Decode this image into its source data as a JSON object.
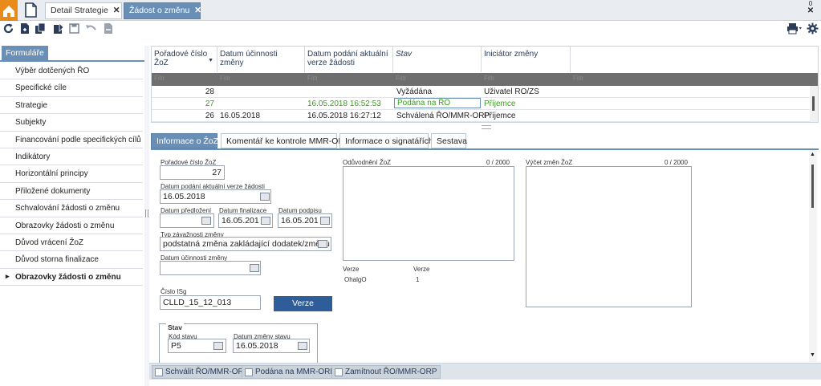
{
  "tabs": [
    {
      "label": "Detail Strategie",
      "close": "✕"
    },
    {
      "label": "Žádost o změnu",
      "close": "✕"
    }
  ],
  "window": {
    "minimize": "0",
    "close": "✕"
  },
  "left_panel": {
    "header": "Formuláře",
    "items": [
      "Výběr dotčených ŘO",
      "Specifické cíle",
      "Strategie",
      "Subjekty",
      "Financování podle specifických cílů",
      "Indikátory",
      "Horizontální principy",
      "Přiložené dokumenty",
      "Schvalování žádosti o změnu",
      "Obrazovky žádosti o změnu",
      "Důvod vrácení ŽoZ",
      "Důvod storna finalizace",
      "Obrazovky žádosti o změnu"
    ]
  },
  "grid": {
    "columns": [
      "Pořadové číslo ŽoZ",
      "Datum účinnosti změny",
      "Datum podání aktuální verze žádosti",
      "Stav",
      "Iniciátor změny"
    ],
    "filter_placeholder": "Filtr",
    "rows": [
      {
        "poradove": "28",
        "ucinnost": "",
        "podani": "",
        "stav": "Vyžádána",
        "iniciator": "Uživatel RO/ZS"
      },
      {
        "poradove": "27",
        "ucinnost": "",
        "podani": "16.05.2018 16:52:53",
        "stav": "Podána na ŘO",
        "iniciator": "Příjemce"
      },
      {
        "poradove": "26",
        "ucinnost": "16.05.2018",
        "podani": "16.05.2018 16:27:12",
        "stav": "Schválená ŘO/MMR-ORP",
        "iniciator": "Příjemce"
      }
    ],
    "colors": {
      "selected_row_text": "#3c9a1e",
      "filter_bg": "#6e6e6e"
    }
  },
  "detail_tabs": [
    "Informace o ŽoZ",
    "Komentář ke kontrole MMR-ORP",
    "Informace o signatářích",
    "Sestava"
  ],
  "form": {
    "poradove_label": "Pořadové číslo ŽoZ",
    "poradove_value": "27",
    "podani_label": "Datum podání aktuální verze žádosti",
    "podani_value": "16.05.2018",
    "predlozeni_label": "Datum předložení",
    "predlozeni_value": "",
    "finalizace_label": "Datum finalizace",
    "finalizace_value": "16.05.201",
    "podpisu_label": "Datum podpisu",
    "podpisu_value": "16.05.201",
    "typ_label": "Typ závažnosti změny",
    "typ_value": "podstatná změna zakládající dodatek/změnu",
    "ucinnost_label": "Datum účinnosti změny",
    "ucinnost_value": "",
    "cislo_label": "Číslo ISg",
    "cislo_value": "CLLD_15_12_013",
    "verze_button": "Verze",
    "oduvodneni_label": "Odůvodnění ŽoZ",
    "oduvodneni_count": "0 / 2000",
    "vycet_label": "Výčet změn ŽoZ",
    "vycet_count": "0 / 2000",
    "verze_col1": "Verze",
    "verze_col2": "Verze",
    "verze_val1": "OhalgO",
    "verze_val2": "1",
    "stav_group": "Stav",
    "kod_label": "Kód stavu",
    "kod_value": "P5",
    "datum_zmeny_label": "Datum změny stavu",
    "datum_zmeny_value": "16.05.2018",
    "more": "..."
  },
  "bottom_buttons": [
    "Schválit ŘO/MMR-ORP",
    "Podána na MMR-ORP",
    "Zamítnout ŘO/MMR-ORP"
  ],
  "icons": [
    "home-icon",
    "document-icon",
    "refresh-icon",
    "new-icon",
    "copy-icon",
    "edit-icon",
    "save-icon",
    "undo-icon",
    "delete-icon",
    "print-icon",
    "settings-icon"
  ],
  "colors": {
    "accent": "#6a8fb7",
    "home": "#e98b1b"
  }
}
